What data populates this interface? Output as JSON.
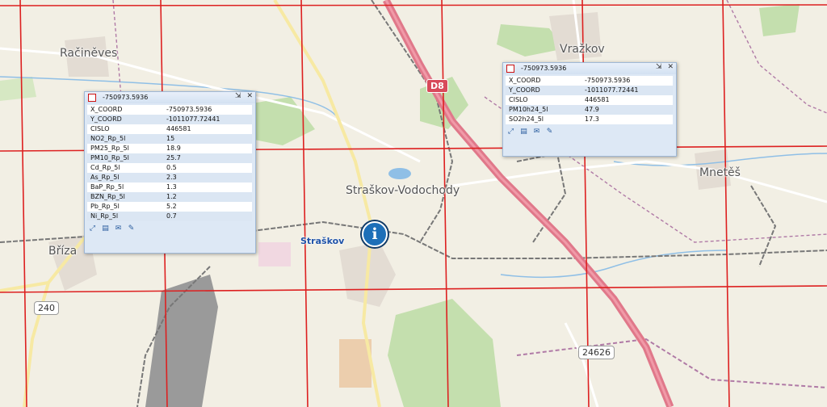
{
  "map": {
    "places": {
      "racineves": "Račiněves",
      "vrazkov": "Vražkov",
      "mnetes": "Mnetěš",
      "briza": "Bříza",
      "straskov_vodochody": "Straškov-Vodochody",
      "straskov_station": "Straškov"
    },
    "roads": {
      "d8": "D8",
      "r240": "240",
      "r24626": "24626"
    },
    "colors": {
      "grid": "#dd2020",
      "motorway": "#e0788a",
      "railway": "#777777",
      "border": "#b07aa6",
      "forest": "#c4dfae",
      "water": "#8fbfe6"
    }
  },
  "popup_left": {
    "title": "-750973.5936",
    "rows": [
      {
        "key": "X_COORD",
        "value": "-750973.5936"
      },
      {
        "key": "Y_COORD",
        "value": "-1011077.72441"
      },
      {
        "key": "CISLO",
        "value": "446581"
      },
      {
        "key": "NO2_Rp_5l",
        "value": "15"
      },
      {
        "key": "PM25_Rp_5l",
        "value": "18.9"
      },
      {
        "key": "PM10_Rp_5l",
        "value": "25.7"
      },
      {
        "key": "Cd_Rp_5l",
        "value": "0.5"
      },
      {
        "key": "As_Rp_5l",
        "value": "2.3"
      },
      {
        "key": "BaP_Rp_5l",
        "value": "1.3"
      },
      {
        "key": "BZN_Rp_5l",
        "value": "1.2"
      },
      {
        "key": "Pb_Rp_5l",
        "value": "5.2"
      },
      {
        "key": "Ni_Rp_5l",
        "value": "0.7"
      }
    ]
  },
  "popup_right": {
    "title": "-750973.5936",
    "rows": [
      {
        "key": "X_COORD",
        "value": "-750973.5936"
      },
      {
        "key": "Y_COORD",
        "value": "-1011077.72441"
      },
      {
        "key": "CISLO",
        "value": "446581"
      },
      {
        "key": "PM10h24_5l",
        "value": "47.9"
      },
      {
        "key": "SO2h24_5l",
        "value": "17.3"
      }
    ]
  },
  "popup_tools": [
    "zoom-to-icon",
    "layers-icon",
    "mail-icon",
    "edit-icon"
  ],
  "popup_buttons": {
    "pin": "⇲",
    "close": "✕"
  }
}
